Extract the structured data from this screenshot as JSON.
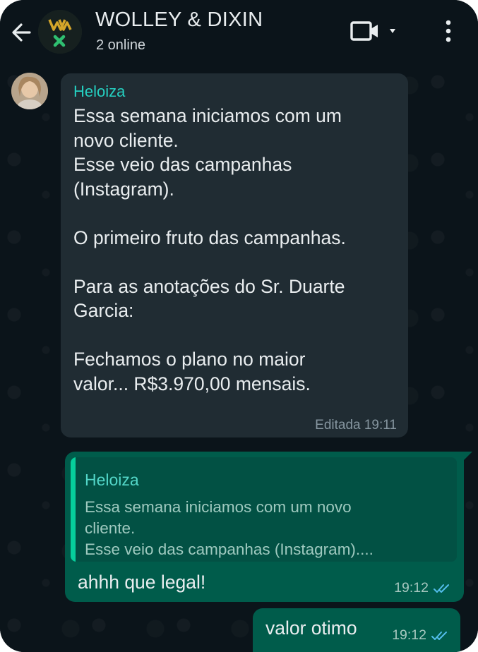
{
  "header": {
    "title": "WOLLEY & DIXIN",
    "subtitle": "2 online"
  },
  "messages": {
    "incoming": {
      "sender": "Heloiza",
      "lines": [
        "Essa semana iniciamos com um",
        "novo cliente.",
        "Esse veio das campanhas",
        "(Instagram).",
        "",
        "O primeiro fruto das campanhas.",
        "",
        "Para as anotações do Sr. Duarte",
        "Garcia:",
        "",
        "Fechamos o plano no maior",
        "valor... R$3.970,00 mensais."
      ],
      "meta": "Editada 19:11"
    },
    "reply": {
      "quote_sender": "Heloiza",
      "quote_lines": [
        "Essa semana iniciamos com um novo",
        "cliente.",
        "Esse veio das campanhas (Instagram)...."
      ],
      "text": "ahhh que legal!",
      "time": "19:12"
    },
    "outgoing": {
      "text": "valor otimo",
      "time": "19:12"
    }
  },
  "colors": {
    "background": "#0b141a",
    "incoming_bubble": "#202c33",
    "outgoing_bubble": "#005c4b",
    "sender_name": "#25d0c1",
    "read_ticks": "#53bdeb"
  },
  "icons": [
    "back-arrow-icon",
    "group-logo-icon",
    "video-call-icon",
    "chevron-down-icon",
    "more-options-icon",
    "double-check-icon"
  ]
}
